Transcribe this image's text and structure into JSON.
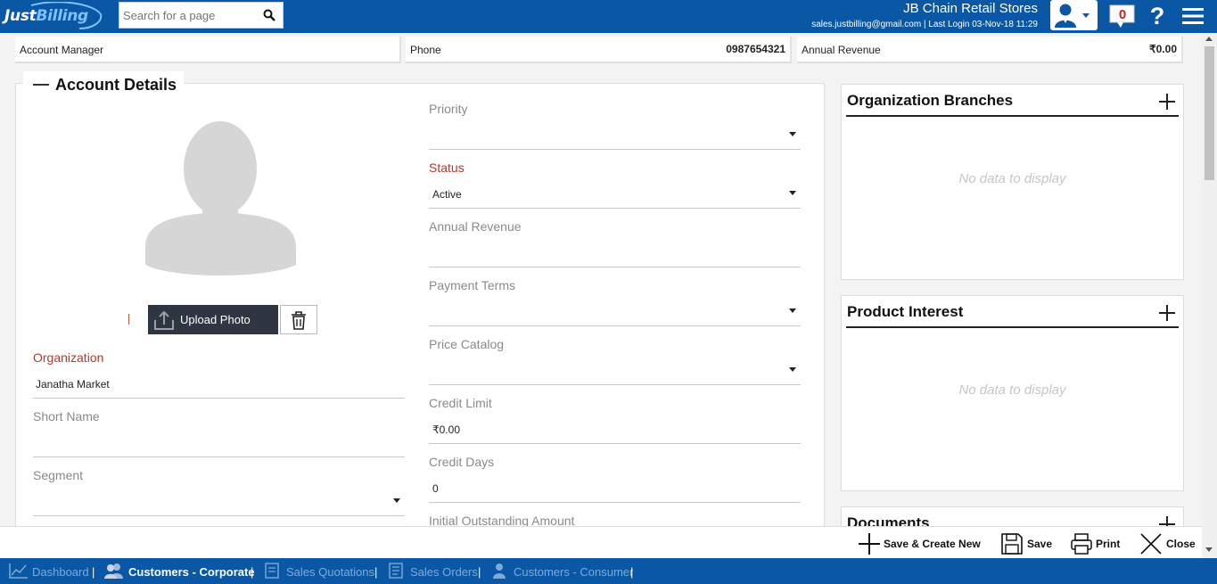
{
  "header": {
    "logo_text_a": "Just",
    "logo_text_b": "Billing",
    "search_placeholder": "Search for a page",
    "store_name": "JB Chain Retail Stores",
    "login_info": "sales.justbilling@gmail.com | Last Login 03-Nov-18 11:29",
    "notification_count": "0",
    "help_label": "?"
  },
  "summary": {
    "account_manager_label": "Account Manager",
    "account_manager_value": "",
    "phone_label": "Phone",
    "phone_value": "0987654321",
    "annual_revenue_label": "Annual Revenue",
    "annual_revenue_value": "₹0.00"
  },
  "account": {
    "title": "Account Details",
    "upload_label": "Upload Photo",
    "left_fields": {
      "organization_label": "Organization",
      "organization_value": "Janatha Market",
      "short_name_label": "Short Name",
      "short_name_value": "",
      "segment_label": "Segment",
      "segment_value": ""
    },
    "right_fields": {
      "priority_label": "Priority",
      "priority_value": "",
      "status_label": "Status",
      "status_value": "Active",
      "annual_revenue_label": "Annual Revenue",
      "annual_revenue_value": "",
      "payment_terms_label": "Payment Terms",
      "payment_terms_value": "",
      "price_catalog_label": "Price Catalog",
      "price_catalog_value": "",
      "credit_limit_label": "Credit Limit",
      "credit_limit_value": "₹0.00",
      "credit_days_label": "Credit Days",
      "credit_days_value": "0",
      "initial_outstanding_label": "Initial Outstanding Amount"
    }
  },
  "panels": {
    "branches_title": "Organization Branches",
    "branches_empty": "No data to display",
    "product_title": "Product Interest",
    "product_empty": "No data to display",
    "documents_title": "Documents"
  },
  "actions": {
    "save_create_new": "Save & Create New",
    "save": "Save",
    "print": "Print",
    "close": "Close"
  },
  "bottom_nav": {
    "items": [
      {
        "label": "Dashboard"
      },
      {
        "label": "Customers - Corporate"
      },
      {
        "label": "Sales Quotations"
      },
      {
        "label": "Sales Orders"
      },
      {
        "label": "Customers - Consumer"
      }
    ],
    "separator": "|"
  },
  "colors": {
    "brand_blue": "#0a57a5",
    "required_label": "#b0392b",
    "button_dark": "#2f3541"
  }
}
